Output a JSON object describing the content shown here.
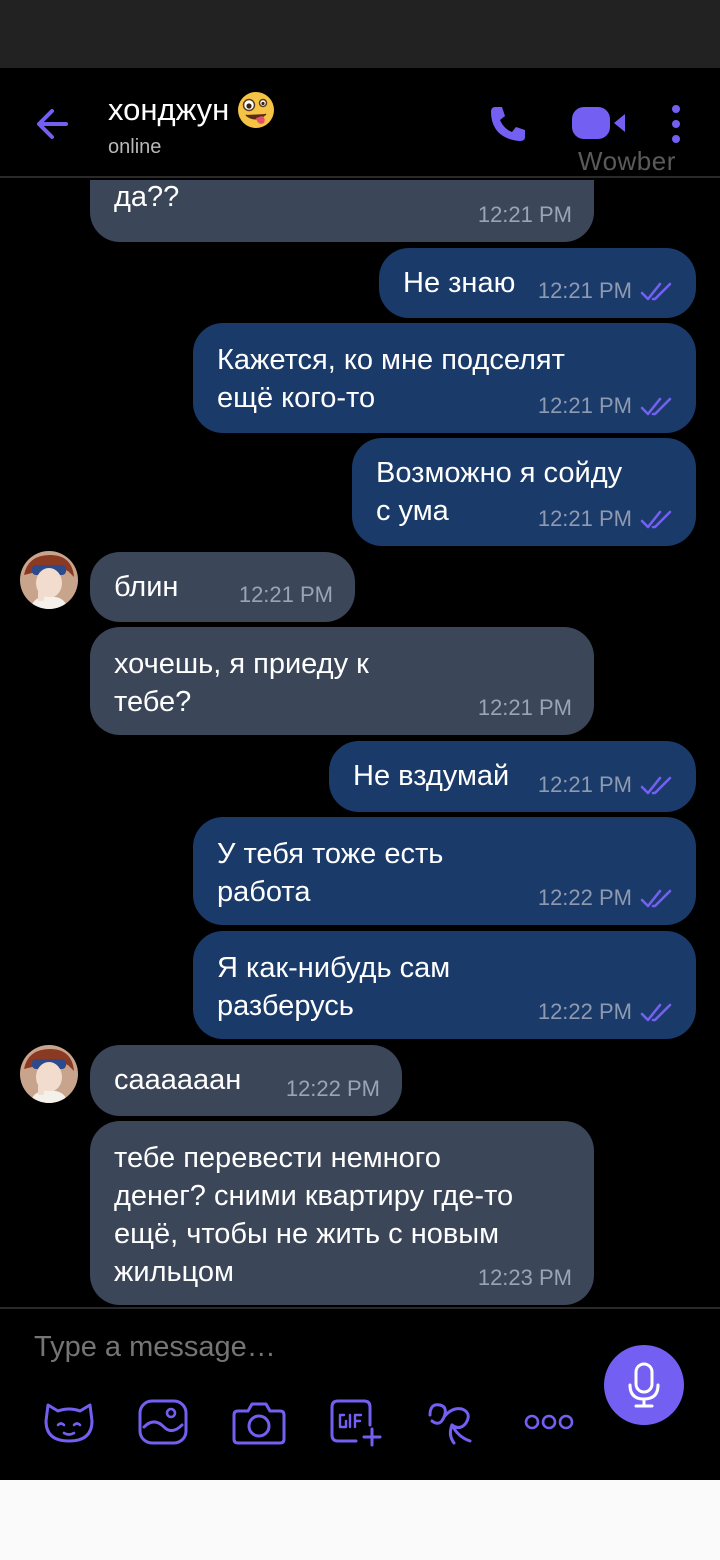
{
  "header": {
    "contact_name": "хонджун",
    "status": "online",
    "watermark": "Wowber"
  },
  "icons": {
    "back": "arrow-left-icon",
    "call": "phone-icon",
    "video": "video-camera-icon",
    "more": "more-vertical-icon",
    "read": "double-check-icon",
    "mic": "microphone-icon",
    "tools": [
      "sticker-icon",
      "gallery-icon",
      "camera-icon",
      "gif-icon",
      "doodle-icon",
      "more-horizontal-icon"
    ]
  },
  "colors": {
    "accent": "#7360f2",
    "incoming_bubble": "#3c4659",
    "outgoing_bubble": "#1a3a6a",
    "background": "#000000"
  },
  "messages": [
    {
      "dir": "in",
      "text": "он же не обманул тебя,\nда??",
      "time": "12:21 PM"
    },
    {
      "dir": "out",
      "text": "Не знаю",
      "time": "12:21 PM"
    },
    {
      "dir": "out",
      "text": "Кажется, ко мне подселят\nещё кого-то",
      "time": "12:21 PM"
    },
    {
      "dir": "out",
      "text": "Возможно я сойду\nс ума",
      "time": "12:21 PM"
    },
    {
      "dir": "in",
      "text": "блин",
      "time": "12:21 PM"
    },
    {
      "dir": "in",
      "text": "хочешь, я приеду к\nтебе?",
      "time": "12:21 PM"
    },
    {
      "dir": "out",
      "text": "Не вздумай",
      "time": "12:21 PM"
    },
    {
      "dir": "out",
      "text": "У тебя тоже есть\nработа",
      "time": "12:22 PM"
    },
    {
      "dir": "out",
      "text": "Я как-нибудь сам\nразберусь",
      "time": "12:22 PM"
    },
    {
      "dir": "in",
      "text": "саааааан",
      "time": "12:22 PM"
    },
    {
      "dir": "in",
      "text": "тебе перевести немного\nденег? сними квартиру где-то\nещё, чтобы не жить с новым\nжильцом",
      "time": "12:23 PM"
    }
  ],
  "composer": {
    "placeholder": "Type a message…"
  }
}
